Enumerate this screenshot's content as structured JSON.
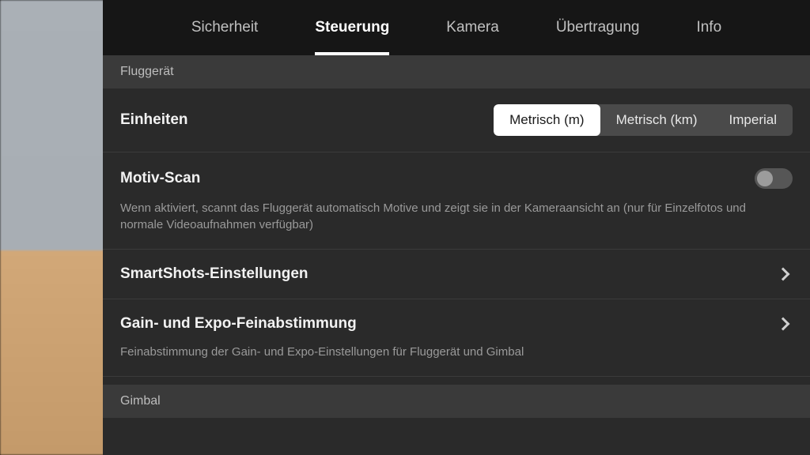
{
  "tabs": [
    {
      "label": "Sicherheit",
      "active": false
    },
    {
      "label": "Steuerung",
      "active": true
    },
    {
      "label": "Kamera",
      "active": false
    },
    {
      "label": "Übertragung",
      "active": false
    },
    {
      "label": "Info",
      "active": false
    }
  ],
  "sections": {
    "aircraft_header": "Fluggerät",
    "gimbal_header": "Gimbal"
  },
  "units": {
    "title": "Einheiten",
    "options": [
      "Metrisch (m)",
      "Metrisch (km)",
      "Imperial"
    ],
    "selected_index": 0
  },
  "motiv_scan": {
    "title": "Motiv-Scan",
    "enabled": false,
    "description": "Wenn aktiviert, scannt das Fluggerät automatisch Motive und zeigt sie in der Kameraansicht an (nur für Einzelfotos und normale Videoaufnahmen verfügbar)"
  },
  "smartshots": {
    "title": "SmartShots-Einstellungen"
  },
  "gain_expo": {
    "title": "Gain- und Expo-Feinabstimmung",
    "description": "Feinabstimmung der Gain- und Expo-Einstellungen für Fluggerät und Gimbal"
  }
}
